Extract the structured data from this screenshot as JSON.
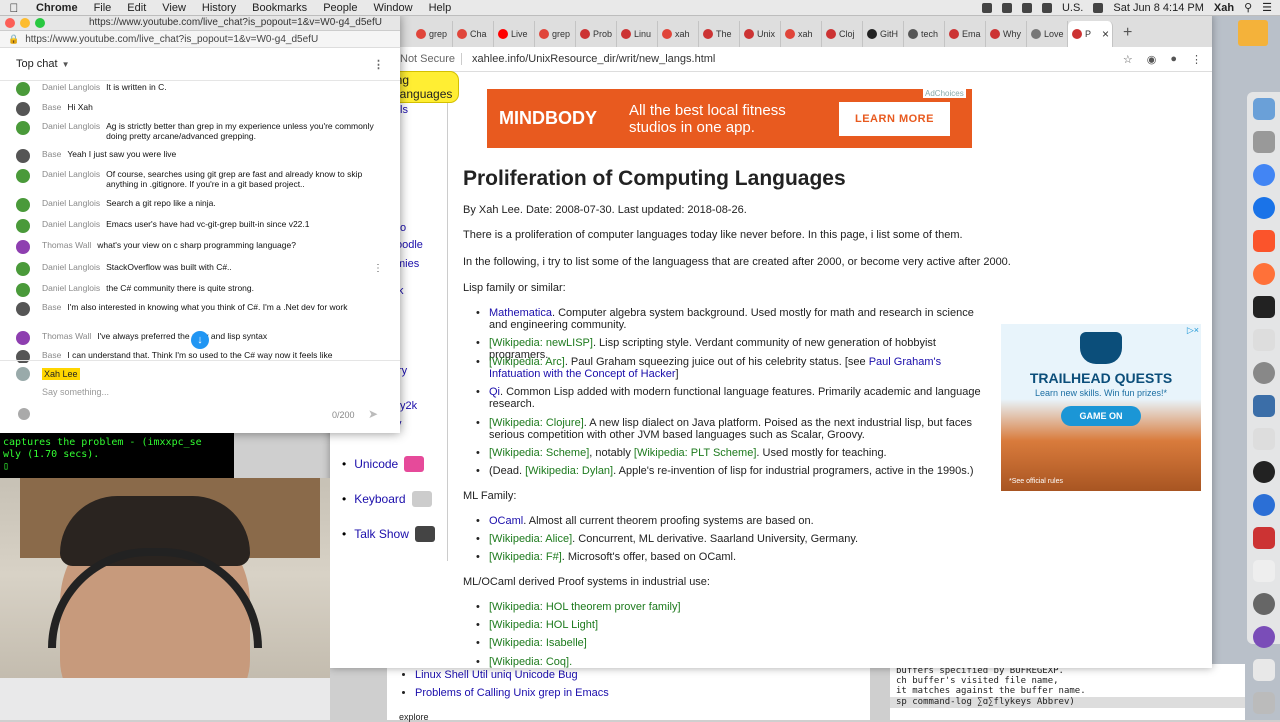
{
  "menubar": {
    "items": [
      "Chrome",
      "File",
      "Edit",
      "View",
      "History",
      "Bookmarks",
      "People",
      "Window",
      "Help"
    ],
    "clock": "Sat Jun 8  4:14 PM",
    "user": "Xah",
    "input": "U.S."
  },
  "chat_window": {
    "title": "https://www.youtube.com/live_chat?is_popout=1&v=W0-g4_d5efU",
    "url": "https://www.youtube.com/live_chat?is_popout=1&v=W0-g4_d5efU",
    "header": "Top chat",
    "messages": [
      {
        "name": "Daniel Langlois",
        "text": "It is written in C.",
        "color": "#4a9a3a"
      },
      {
        "name": "Base",
        "text": "Hi Xah",
        "color": "#555555"
      },
      {
        "name": "Daniel Langlois",
        "text": "Ag is strictly better than grep in my experience unless you're commonly doing pretty arcane/advanced grepping.",
        "color": "#4a9a3a"
      },
      {
        "name": "Base",
        "text": "Yeah I just saw you were live",
        "color": "#555555"
      },
      {
        "name": "Daniel Langlois",
        "text": "Of course, searches using git grep are fast and already know to skip anything in .gitignore. If you're in a git based project..",
        "color": "#4a9a3a"
      },
      {
        "name": "Daniel Langlois",
        "text": "Search a git repo like a ninja.",
        "color": "#4a9a3a"
      },
      {
        "name": "Daniel Langlois",
        "text": "Emacs user's have had vc-git-grep built-in since v22.1",
        "color": "#4a9a3a"
      },
      {
        "name": "Thomas Wall",
        "text": "what's your view on c sharp programming language?",
        "color": "#8e3fb0"
      },
      {
        "name": "Daniel Langlois",
        "text": "StackOverflow was built with C#..",
        "color": "#4a9a3a"
      },
      {
        "name": "Daniel Langlois",
        "text": "the C# community there is quite strong.",
        "color": "#4a9a3a"
      },
      {
        "name": "Base",
        "text": "I'm also interested in knowing what you think of C#. I'm a .Net dev for work",
        "color": "#555555"
      },
      {
        "name": "Thomas Wall",
        "text": "I've always preferred the ruby and lisp syntax",
        "color": "#8e3fb0"
      },
      {
        "name": "Base",
        "text": "I can understand that. Think I'm so used to the C# way now it feels like",
        "color": "#555555"
      }
    ],
    "input_author": "Xah Lee",
    "input_placeholder": "Say something...",
    "char_count": "0/200"
  },
  "browser": {
    "tabs": [
      "grep",
      "Cha",
      "Live",
      "grep",
      "Prob",
      "Linu",
      "xah",
      "The",
      "Unix",
      "xah",
      "Cloj",
      "GitH",
      "tech",
      "Ema",
      "Why",
      "Love",
      "P"
    ],
    "security": "Not Secure",
    "url": "xahlee.info/UnixResource_dir/writ/new_langs.html"
  },
  "nav": {
    "chip": "ing Languages",
    "fragments": [
      "ls",
      "o",
      "oodle",
      "mies",
      "k",
      "ry",
      "y2k",
      "v"
    ],
    "items": [
      "Unicode",
      "Keyboard",
      "Talk Show"
    ]
  },
  "ad_banner": {
    "brand": "MINDBODY",
    "text": "All the best local fitness studios in one app.",
    "button": "LEARN MORE",
    "choices": "AdChoices"
  },
  "article": {
    "title": "Proliferation of Computing Languages",
    "byline": "By Xah Lee. Date: 2008-07-30. Last updated: 2018-08-26.",
    "intro": "There is a proliferation of computer languages today like never before. In this page, i list some of them.",
    "intro2": "In the following, i try to list some of the languagess that are created after 2000, or become very active after 2000.",
    "lisp_heading": "Lisp family or similar:",
    "lisp": [
      {
        "link": "Mathematica",
        "text": ". Computer algebra system background. Used mostly for math and research in science and engineering community."
      },
      {
        "link": "[Wikipedia: newLISP]",
        "text": ". Lisp scripting style. Verdant community of new generation of hobbyist programers."
      },
      {
        "link": "[Wikipedia: Arc]",
        "text": ". Paul Graham squeezing juice out of his celebrity status. [see ",
        "link2": "Paul Graham's Infatuation with the Concept of Hacker",
        "tail": "]"
      },
      {
        "link": "Qi",
        "text": ". Common Lisp added with modern functional language features. Primarily academic and language research."
      },
      {
        "link": "[Wikipedia: Clojure]",
        "text": ". A new lisp dialect on Java platform. Poised as the next industrial lisp, but faces serious competition with other JVM based languages such as Scalar, Groovy."
      },
      {
        "link": "[Wikipedia: Scheme]",
        "text": ", notably ",
        "link2": "[Wikipedia: PLT Scheme]",
        "tail": ". Used mostly for teaching."
      },
      {
        "pre": "(Dead. ",
        "link": "[Wikipedia: Dylan]",
        "text": ". Apple's re-invention of lisp for industrial programers, active in the 1990s.)"
      }
    ],
    "ml_heading": "ML Family:",
    "ml": [
      {
        "link": "OCaml",
        "text": ". Almost all current theorem proofing systems are based on."
      },
      {
        "link": "[Wikipedia: Alice]",
        "text": ". Concurrent, ML derivative. Saarland University, Germany."
      },
      {
        "link": "[Wikipedia: F#]",
        "text": ". Microsoft's offer, based on OCaml."
      }
    ],
    "proof_heading": "ML/OCaml derived Proof systems in industrial use:",
    "proof": [
      "[Wikipedia: HOL theorem prover family]",
      "[Wikipedia: HOL Light]",
      "[Wikipedia: Isabelle]",
      "[Wikipedia: Coq]."
    ]
  },
  "trail_ad": {
    "title": "TRAILHEAD QUESTS",
    "sub": "Learn new skills. Win fun prizes!*",
    "button": "GAME ON",
    "footnote": "*See official rules"
  },
  "terminal_lines": [
    "captures the problem - (imxxpc_se",
    "wly (1.70 secs).",
    ""
  ],
  "bottom_links": [
    "Linux Shell Util uniq Unicode Bug",
    "Problems of Calling Unix grep in Emacs"
  ],
  "bottom_explore": "explore",
  "emacs_lines": [
    "buffers specified by BUFREGEXP.",
    "ch buffer's visited file name,",
    "it matches against the buffer name."
  ],
  "emacs_modeline": "sp command-log ∑ɑ∑flykeys Abbrev)"
}
